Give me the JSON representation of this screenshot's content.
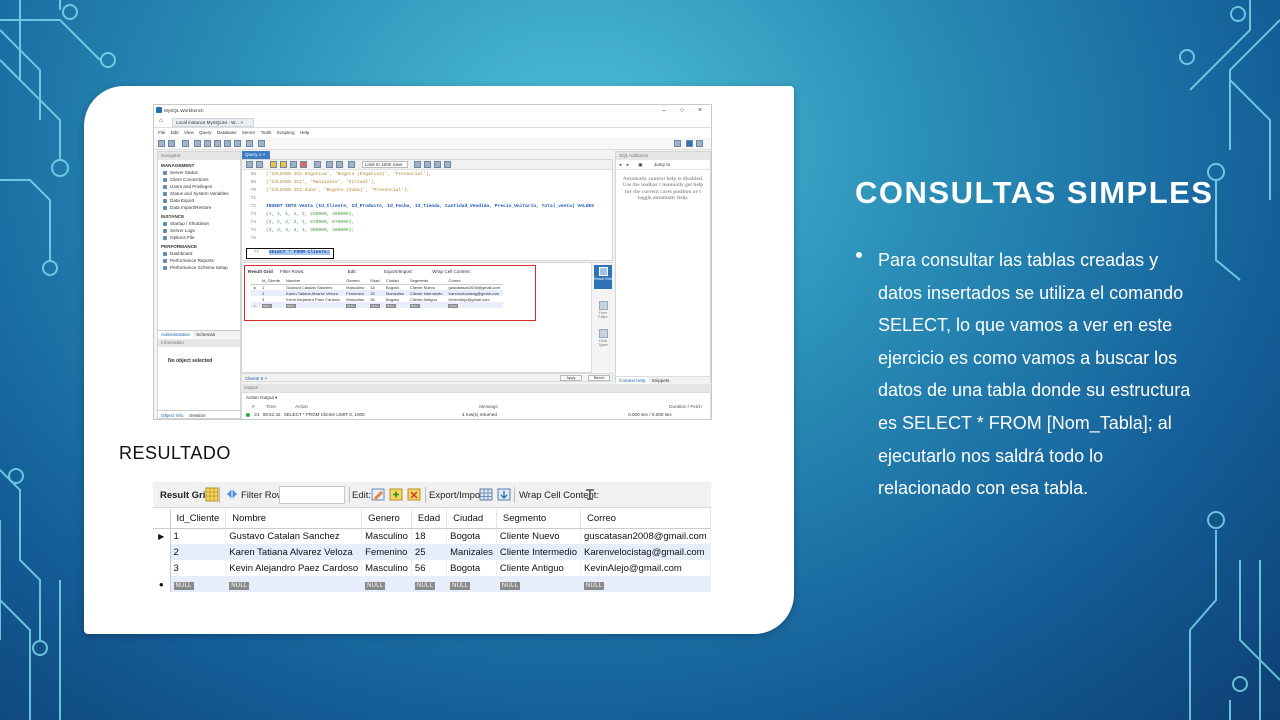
{
  "slide": {
    "title": "CONSULTAS SIMPLES",
    "bullet": "Para consultar las tablas creadas y datos insertados se utiliza el comando SELECT, lo que vamos a ver en este ejercicio es como vamos a buscar los datos de una tabla donde su estructura es SELECT * FROM [Nom_Tabla]; al ejecutarlo nos saldrá todo lo relacionado con esa tabla.",
    "resultado_label": "RESULTADO",
    "colors": {
      "accent_title": "#ffffff",
      "highlight_red": "#d62b2b"
    }
  },
  "workbench": {
    "window_title": "MySQL Workbench",
    "tab_label": "Local instance MySQL94 - W...",
    "menu": [
      "File",
      "Edit",
      "View",
      "Query",
      "Database",
      "Server",
      "Tools",
      "Scripting",
      "Help"
    ],
    "navigator": {
      "header": "Navigator",
      "sections": [
        {
          "title": "MANAGEMENT",
          "items": [
            "Server Status",
            "Client Connections",
            "Users and Privileges",
            "Status and System Variables",
            "Data Export",
            "Data Import/Restore"
          ]
        },
        {
          "title": "INSTANCE",
          "items": [
            "Startup / Shutdown",
            "Server Logs",
            "Options File"
          ]
        },
        {
          "title": "PERFORMANCE",
          "items": [
            "Dashboard",
            "Performance Reports",
            "Performance Schema Setup"
          ]
        }
      ],
      "tabs": [
        "Administration",
        "Schemas"
      ],
      "info_header": "Information",
      "no_selection": "No object selected",
      "bottom_tabs": [
        "Object Info",
        "Session"
      ]
    },
    "query_tab": "Query 1",
    "limit_rows": "Limit to 1000 rows",
    "code_lines": [
      {
        "n": "68",
        "text": "('CALZADO JC2 Engativa', 'Bogota (Engativa)', 'Presencial'),"
      },
      {
        "n": "69",
        "text": "('CALZADO JC1', 'Manizales', 'Virtual'),"
      },
      {
        "n": "70",
        "text": "('CALZADO JC2 Suba', 'Bogota (Suba)', 'Presencial');"
      },
      {
        "n": "71",
        "text": ""
      },
      {
        "n": "72",
        "text": "INSERT INTO Venta (Id_Cliente, Id_Producto, Id_Fecha, Id_Tienda, Cantidad_Vendida, Precio_Unitario, Total_venta) VALUES"
      },
      {
        "n": "73",
        "text": "(1, 1, 1, 1, 2, 230000, 460000),"
      },
      {
        "n": "74",
        "text": "(2, 2, 2, 2, 1, 670000, 670000),"
      },
      {
        "n": "75",
        "text": "(3, 3, 3, 3, 1, 300000, 300000);"
      },
      {
        "n": "76",
        "text": ""
      }
    ],
    "select_line": {
      "n": "77",
      "text": "SELECT * FROM Cliente;"
    },
    "mini_grid": {
      "toolbar": [
        "Result Grid",
        "Filter Rows:",
        "Edit:",
        "Export/Import:",
        "Wrap Cell Content:"
      ],
      "columns": [
        "Id_Cliente",
        "Nombre",
        "Genero",
        "Edad",
        "Ciudad",
        "Segmento",
        "Correo"
      ],
      "rows": [
        [
          "1",
          "Gustavo Catalan Sanchez",
          "Masculino",
          "18",
          "Bogota",
          "Cliente Nuevo",
          "guscatasan2008@gmail.com"
        ],
        [
          "2",
          "Karen Tatiana Alvarez Veloza",
          "Femenino",
          "25",
          "Manizales",
          "Cliente Intermedio",
          "Karenvelocistag@gmail.com"
        ],
        [
          "3",
          "Kevin Alejandro Paez Cardoso",
          "Masculino",
          "56",
          "Bogota",
          "Cliente Antiguo",
          "KevinAlejo@gmail.com"
        ]
      ]
    },
    "side_buttons": [
      "Result Grid",
      "Form Editor",
      "Field Types"
    ],
    "status_tab": "Cliente 5",
    "apply": "Apply",
    "revert": "Revert",
    "right_panel": {
      "header": "SQL Additions",
      "jump": "Jump to",
      "help": "Automatic context help is disabled. Use the toolbar t manually get help for the current caret position or t toggle automatic help.",
      "tabs": [
        "Context Help",
        "Snippets"
      ]
    },
    "output": {
      "header": "Output",
      "selector": "Action Output",
      "columns": [
        "#",
        "Time",
        "Action",
        "Message",
        "Duration / Fetch"
      ],
      "row": {
        "num": "21",
        "time": "06:51:42",
        "action": "SELECT * FROM Cliente LIMIT 0, 1000",
        "message": "3 row(s) returned",
        "duration": "0.000 sec / 0.000 sec"
      }
    }
  },
  "result_grid": {
    "toolbar": {
      "result_grid": "Result Grid",
      "filter_rows": "Filter Rows:",
      "edit": "Edit:",
      "export_import": "Export/Import:",
      "wrap": "Wrap Cell Content:"
    },
    "columns": [
      "Id_Cliente",
      "Nombre",
      "Genero",
      "Edad",
      "Ciudad",
      "Segmento",
      "Correo"
    ],
    "rows": [
      [
        "1",
        "Gustavo Catalan Sanchez",
        "Masculino",
        "18",
        "Bogota",
        "Cliente Nuevo",
        "guscatasan2008@gmail.com"
      ],
      [
        "2",
        "Karen Tatiana Alvarez Veloza",
        "Femenino",
        "25",
        "Manizales",
        "Cliente Intermedio",
        "Karenvelocistag@gmail.com"
      ],
      [
        "3",
        "Kevin Alejandro Paez Cardoso",
        "Masculino",
        "56",
        "Bogota",
        "Cliente Antiguo",
        "KevinAlejo@gmail.com"
      ]
    ],
    "null_label": "NULL"
  }
}
